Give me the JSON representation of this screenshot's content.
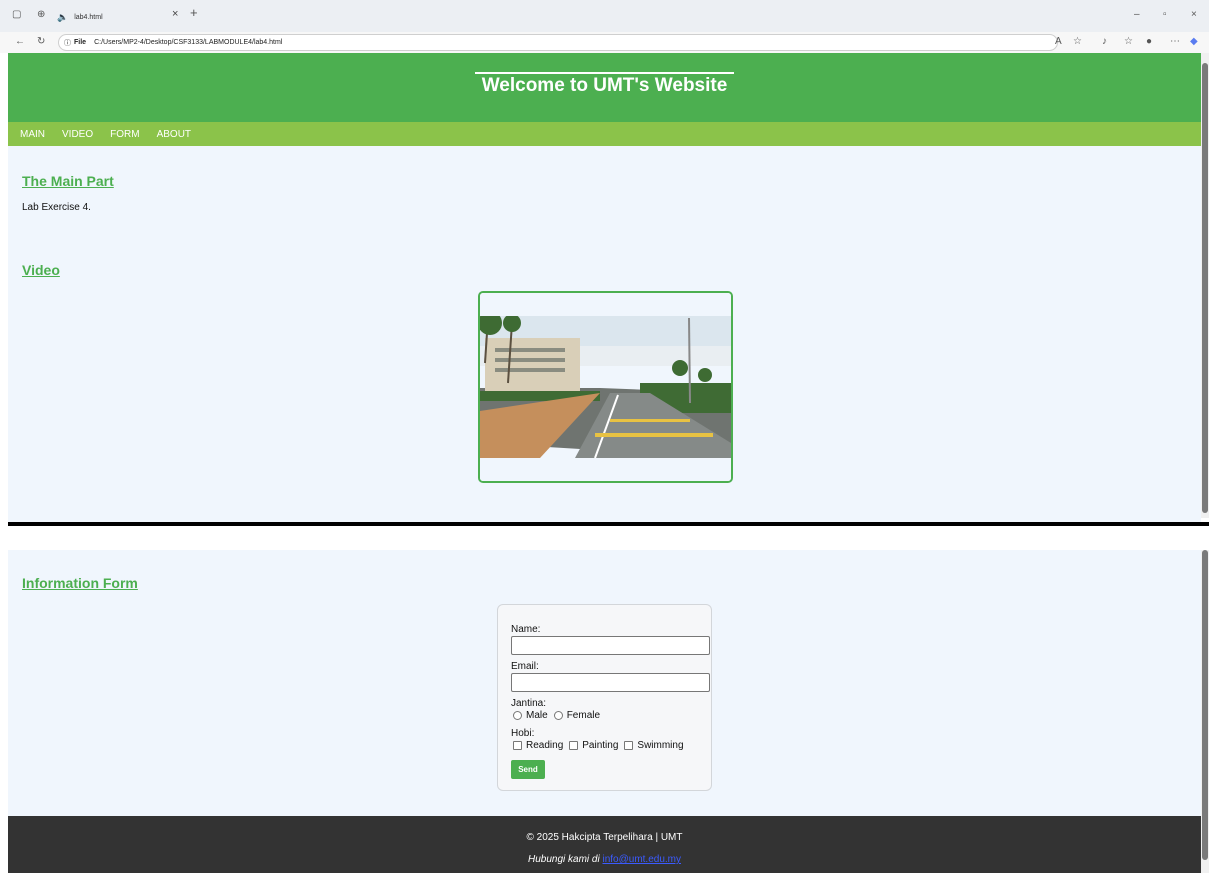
{
  "browser": {
    "tab_title": "lab4.html",
    "url_scheme_label": "File",
    "url": "C:/Users/MP2-4/Desktop/CSF3133/LABMODULE4/lab4.html"
  },
  "header": {
    "title": "Welcome to UMT's Website"
  },
  "nav": {
    "items": [
      "MAIN",
      "VIDEO",
      "FORM",
      "ABOUT"
    ]
  },
  "main": {
    "section1_title": "The Main Part",
    "section1_text": "Lab Exercise 4.",
    "section2_title": "Video"
  },
  "form_section": {
    "title": "Information Form",
    "name_label": "Name:",
    "email_label": "Email:",
    "gender_label": "Jantina:",
    "gender_options": [
      "Male",
      "Female"
    ],
    "hobby_label": "Hobi:",
    "hobby_options": [
      "Reading",
      "Painting",
      "Swimming"
    ],
    "send_label": "Send"
  },
  "footer": {
    "copyright": "© 2025 Hakcipta Terpelihara | UMT",
    "contact_prefix": "Hubungi kami di",
    "contact_link": "info@umt.edu.my"
  },
  "colors": {
    "header_green": "#4caf50",
    "nav_green": "#8bc34a",
    "page_bg": "#f0f6fd",
    "footer_bg": "#333333"
  }
}
